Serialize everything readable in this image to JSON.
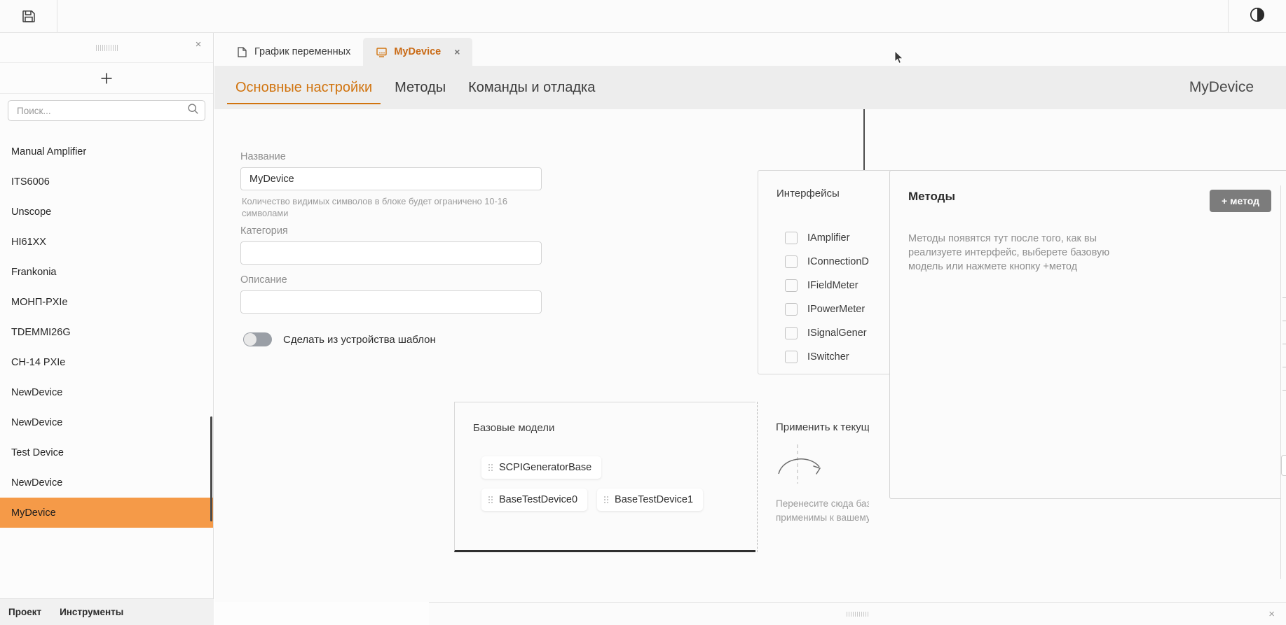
{
  "toolbar": {
    "save_icon": "floppy-save-icon",
    "theme_icon": "theme-contrast-icon"
  },
  "sidebar": {
    "grip": "drag-handle",
    "close_label": "×",
    "add_label": "+",
    "search": {
      "placeholder": "Поиск...",
      "value": "",
      "icon": "search-icon"
    },
    "items": [
      {
        "label": "",
        "active": false,
        "clipped": true
      },
      {
        "label": "Manual Amplifier",
        "active": false
      },
      {
        "label": "ITS6006",
        "active": false
      },
      {
        "label": "Unscope",
        "active": false
      },
      {
        "label": "HI61XX",
        "active": false
      },
      {
        "label": "Frankonia",
        "active": false
      },
      {
        "label": "МОНП-PXIe",
        "active": false
      },
      {
        "label": "TDEMMI26G",
        "active": false
      },
      {
        "label": "CH-14 PXIe",
        "active": false
      },
      {
        "label": "NewDevice",
        "active": false
      },
      {
        "label": "NewDevice",
        "active": false
      },
      {
        "label": "Test Device",
        "active": false
      },
      {
        "label": "NewDevice",
        "active": false
      },
      {
        "label": "MyDevice",
        "active": true
      }
    ],
    "footer": {
      "project": "Проект",
      "tools": "Инструменты"
    },
    "accent_color": "#f59a48"
  },
  "tabs": [
    {
      "label": "График переменных",
      "icon": "document-icon",
      "active": false,
      "closable": false
    },
    {
      "label": "MyDevice",
      "icon": "device-icon",
      "active": true,
      "closable": true,
      "close_label": "×"
    }
  ],
  "subtabs": [
    {
      "label": "Основные настройки",
      "active": true
    },
    {
      "label": "Методы",
      "active": false
    },
    {
      "label": "Команды и отладка",
      "active": false
    }
  ],
  "page_title": "MyDevice",
  "form": {
    "name_label": "Название",
    "name_value": "MyDevice",
    "name_help": "Количество видимых символов в блоке будет ограничено 10-16 символами",
    "category_label": "Категория",
    "category_value": "",
    "description_label": "Описание",
    "description_value": "",
    "toggle_label": "Сделать из устройства шаблон",
    "toggle_state": "off"
  },
  "interfaces": {
    "title": "Интерфейсы",
    "items": [
      {
        "label": "IAmplifier",
        "checked": false
      },
      {
        "label": "IConnectionD",
        "checked": false
      },
      {
        "label": "IFieldMeter",
        "checked": false
      },
      {
        "label": "IPowerMeter",
        "checked": false
      },
      {
        "label": "ISignalGener",
        "checked": false
      },
      {
        "label": "ISwitcher",
        "checked": false
      }
    ]
  },
  "methods": {
    "title": "Методы",
    "add_button": "+ метод",
    "empty_text": "Методы появятся тут после того, как вы реализуете интерфейс, выберете базовую модель или нажмете кнопку +метод"
  },
  "base_models": {
    "title": "Базовые модели",
    "chips": [
      "SCPIGeneratorBase",
      "BaseTestDevice0",
      "BaseTestDevice1"
    ]
  },
  "dropzone": {
    "title": "Применить к текущ",
    "icon": "curved-arrow-icon",
    "line1": "Перенесите сюда базо",
    "line2": "применимы к вашему"
  },
  "statusbar": {
    "grip": "drag-handle",
    "close_label": "×"
  }
}
